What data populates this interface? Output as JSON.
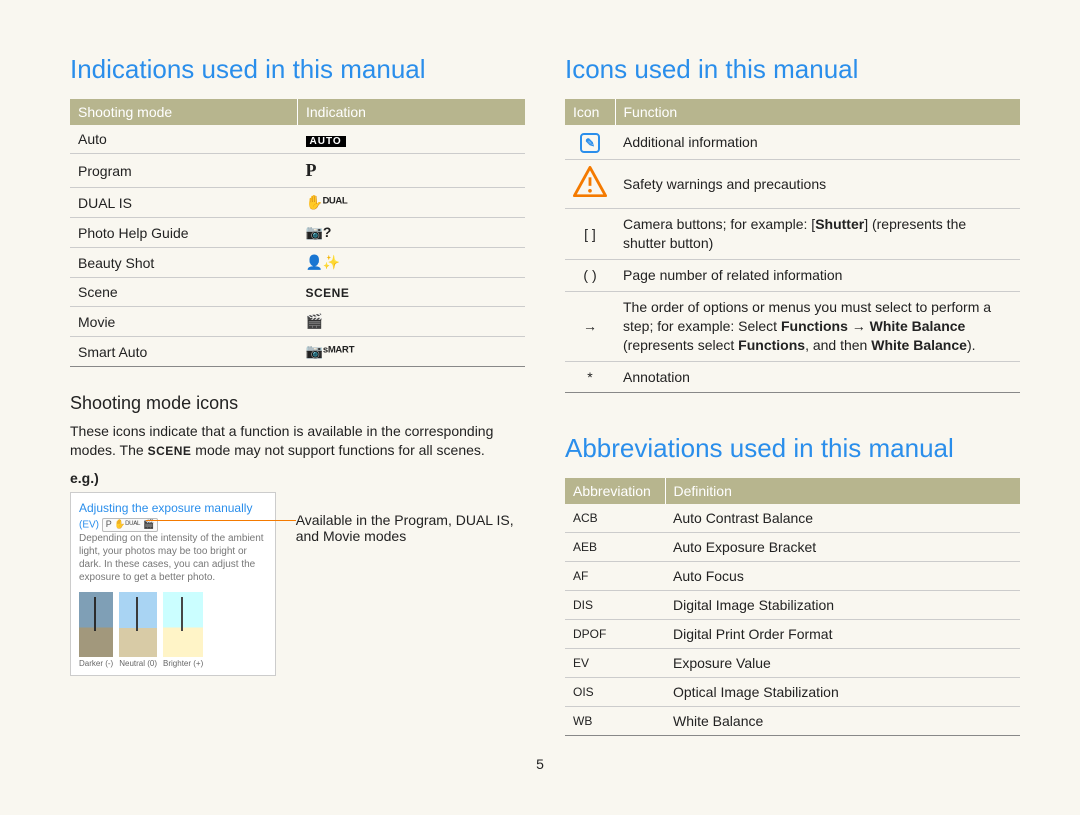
{
  "left": {
    "heading": "Indications used in this manual",
    "table": {
      "headers": [
        "Shooting mode",
        "Indication"
      ],
      "rows": [
        {
          "mode": "Auto",
          "indication_type": "badge",
          "indication": "AUTO"
        },
        {
          "mode": "Program",
          "indication_type": "p",
          "indication": "P"
        },
        {
          "mode": "DUAL IS",
          "indication_type": "dual",
          "indication": "✋ᴰᵁᴬᴸ"
        },
        {
          "mode": "Photo Help Guide",
          "indication_type": "glyph",
          "indication": "📷?"
        },
        {
          "mode": "Beauty Shot",
          "indication_type": "glyph",
          "indication": "👤✨"
        },
        {
          "mode": "Scene",
          "indication_type": "scene",
          "indication": "SCENE"
        },
        {
          "mode": "Movie",
          "indication_type": "glyph",
          "indication": "🎬"
        },
        {
          "mode": "Smart Auto",
          "indication_type": "smart",
          "indication": "📷ˢᴹᴬᴿᵀ"
        }
      ]
    },
    "subheading": "Shooting mode icons",
    "desc_pre": "These icons indicate that a function is available in the corresponding modes. The ",
    "desc_scene": "SCENE",
    "desc_post": " mode may not support functions for all scenes.",
    "eg_label": "e.g.)",
    "eg_box": {
      "title": "Adjusting the exposure manually",
      "ev_label": "(EV)",
      "icons_placeholder": "P ✋ᴰᵁᴬᴸ 🎬",
      "body": "Depending on the intensity of the ambient light, your photos may be too bright or dark. In these cases, you can adjust the exposure to get a better photo.",
      "thumb_labels": [
        "Darker (-)",
        "Neutral (0)",
        "Brighter (+)"
      ]
    },
    "callout": "Available in the Program, DUAL IS, and Movie modes"
  },
  "right": {
    "icons_heading": "Icons used in this manual",
    "icons_table": {
      "headers": [
        "Icon",
        "Function"
      ],
      "rows": [
        {
          "icon_type": "note",
          "icon": "✎",
          "text": "Additional information"
        },
        {
          "icon_type": "warn",
          "icon": "!",
          "text": "Safety warnings and precautions"
        },
        {
          "icon_type": "text",
          "icon": "[ ]",
          "text_pre": "Camera buttons; for example: [",
          "text_bold": "Shutter",
          "text_post": "] (represents the shutter button)"
        },
        {
          "icon_type": "text",
          "icon": "( )",
          "text": "Page number of related information"
        },
        {
          "icon_type": "text",
          "icon": "→",
          "text_pre": "The order of options or menus you must select to perform a step; for example: Select ",
          "seq": [
            "Functions",
            " → ",
            "White Balance",
            " (represents select ",
            "Functions",
            ", and then ",
            "White Balance",
            ")."
          ]
        },
        {
          "icon_type": "text",
          "icon": "*",
          "text": "Annotation"
        }
      ]
    },
    "abbr_heading": "Abbreviations used in this manual",
    "abbr_table": {
      "headers": [
        "Abbreviation",
        "Definition"
      ],
      "rows": [
        {
          "abbr": "ACB",
          "def": "Auto Contrast Balance"
        },
        {
          "abbr": "AEB",
          "def": "Auto Exposure Bracket"
        },
        {
          "abbr": "AF",
          "def": "Auto Focus"
        },
        {
          "abbr": "DIS",
          "def": "Digital Image Stabilization"
        },
        {
          "abbr": "DPOF",
          "def": "Digital Print Order Format"
        },
        {
          "abbr": "EV",
          "def": "Exposure Value"
        },
        {
          "abbr": "OIS",
          "def": "Optical Image Stabilization"
        },
        {
          "abbr": "WB",
          "def": "White Balance"
        }
      ]
    }
  },
  "page_number": "5",
  "chart_data": {
    "type": "table",
    "tables": [
      {
        "title": "Indications used in this manual",
        "columns": [
          "Shooting mode",
          "Indication"
        ],
        "rows": [
          [
            "Auto",
            "AUTO"
          ],
          [
            "Program",
            "P"
          ],
          [
            "DUAL IS",
            "DUAL"
          ],
          [
            "Photo Help Guide",
            "(hand+? icon)"
          ],
          [
            "Beauty Shot",
            "(face icon)"
          ],
          [
            "Scene",
            "SCENE"
          ],
          [
            "Movie",
            "(movie icon)"
          ],
          [
            "Smart Auto",
            "SMART"
          ]
        ]
      },
      {
        "title": "Icons used in this manual",
        "columns": [
          "Icon",
          "Function"
        ],
        "rows": [
          [
            "(note icon)",
            "Additional information"
          ],
          [
            "(warning icon)",
            "Safety warnings and precautions"
          ],
          [
            "[ ]",
            "Camera buttons; for example: [Shutter] (represents the shutter button)"
          ],
          [
            "( )",
            "Page number of related information"
          ],
          [
            "→",
            "The order of options or menus you must select to perform a step; for example: Select Functions → White Balance (represents select Functions, and then White Balance)."
          ],
          [
            "*",
            "Annotation"
          ]
        ]
      },
      {
        "title": "Abbreviations used in this manual",
        "columns": [
          "Abbreviation",
          "Definition"
        ],
        "rows": [
          [
            "ACB",
            "Auto Contrast Balance"
          ],
          [
            "AEB",
            "Auto Exposure Bracket"
          ],
          [
            "AF",
            "Auto Focus"
          ],
          [
            "DIS",
            "Digital Image Stabilization"
          ],
          [
            "DPOF",
            "Digital Print Order Format"
          ],
          [
            "EV",
            "Exposure Value"
          ],
          [
            "OIS",
            "Optical Image Stabilization"
          ],
          [
            "WB",
            "White Balance"
          ]
        ]
      }
    ]
  }
}
